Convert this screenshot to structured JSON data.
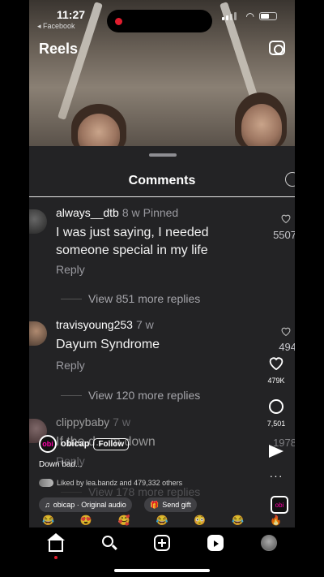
{
  "status_bar": {
    "time": "11:27",
    "back_app": "◂ Facebook"
  },
  "header": {
    "title": "Reels"
  },
  "comments_sheet": {
    "title": "Comments",
    "comments": [
      {
        "username": "always__dtb",
        "age": "8 w",
        "pinned": "Pinned",
        "text": "I was just saying, I needed someone special in my life",
        "reply": "Reply",
        "likes": "5507",
        "view_more": "View 851 more replies"
      },
      {
        "username": "travisyoung253",
        "age": "7 w",
        "pinned": "",
        "text": "Dayum Syndrome",
        "reply": "Reply",
        "likes": "494",
        "view_more": "View 120 more replies"
      },
      {
        "username": "clippybaby",
        "age": "7 w",
        "pinned": "",
        "text": "If the d... m down",
        "reply": "Reply",
        "likes": "1978",
        "view_more": "View 178 more replies"
      }
    ]
  },
  "reel_overlay": {
    "username": "obicap",
    "follow_label": "Follow",
    "caption": "Down bad...",
    "liked_by": "Liked by lea.bandz and 479,332 others",
    "audio_label": "obicap · Original audio",
    "gift_label": "Send gift",
    "like_count": "479K",
    "comment_count": "7,501",
    "more_label": "···"
  },
  "emojis": [
    "😂",
    "😍",
    "🥰",
    "😂",
    "😳",
    "😂",
    "🔥"
  ],
  "nav": {
    "home": "home-icon",
    "search": "search-icon",
    "create": "create-icon",
    "reels": "reels-icon",
    "profile": "profile-icon"
  }
}
